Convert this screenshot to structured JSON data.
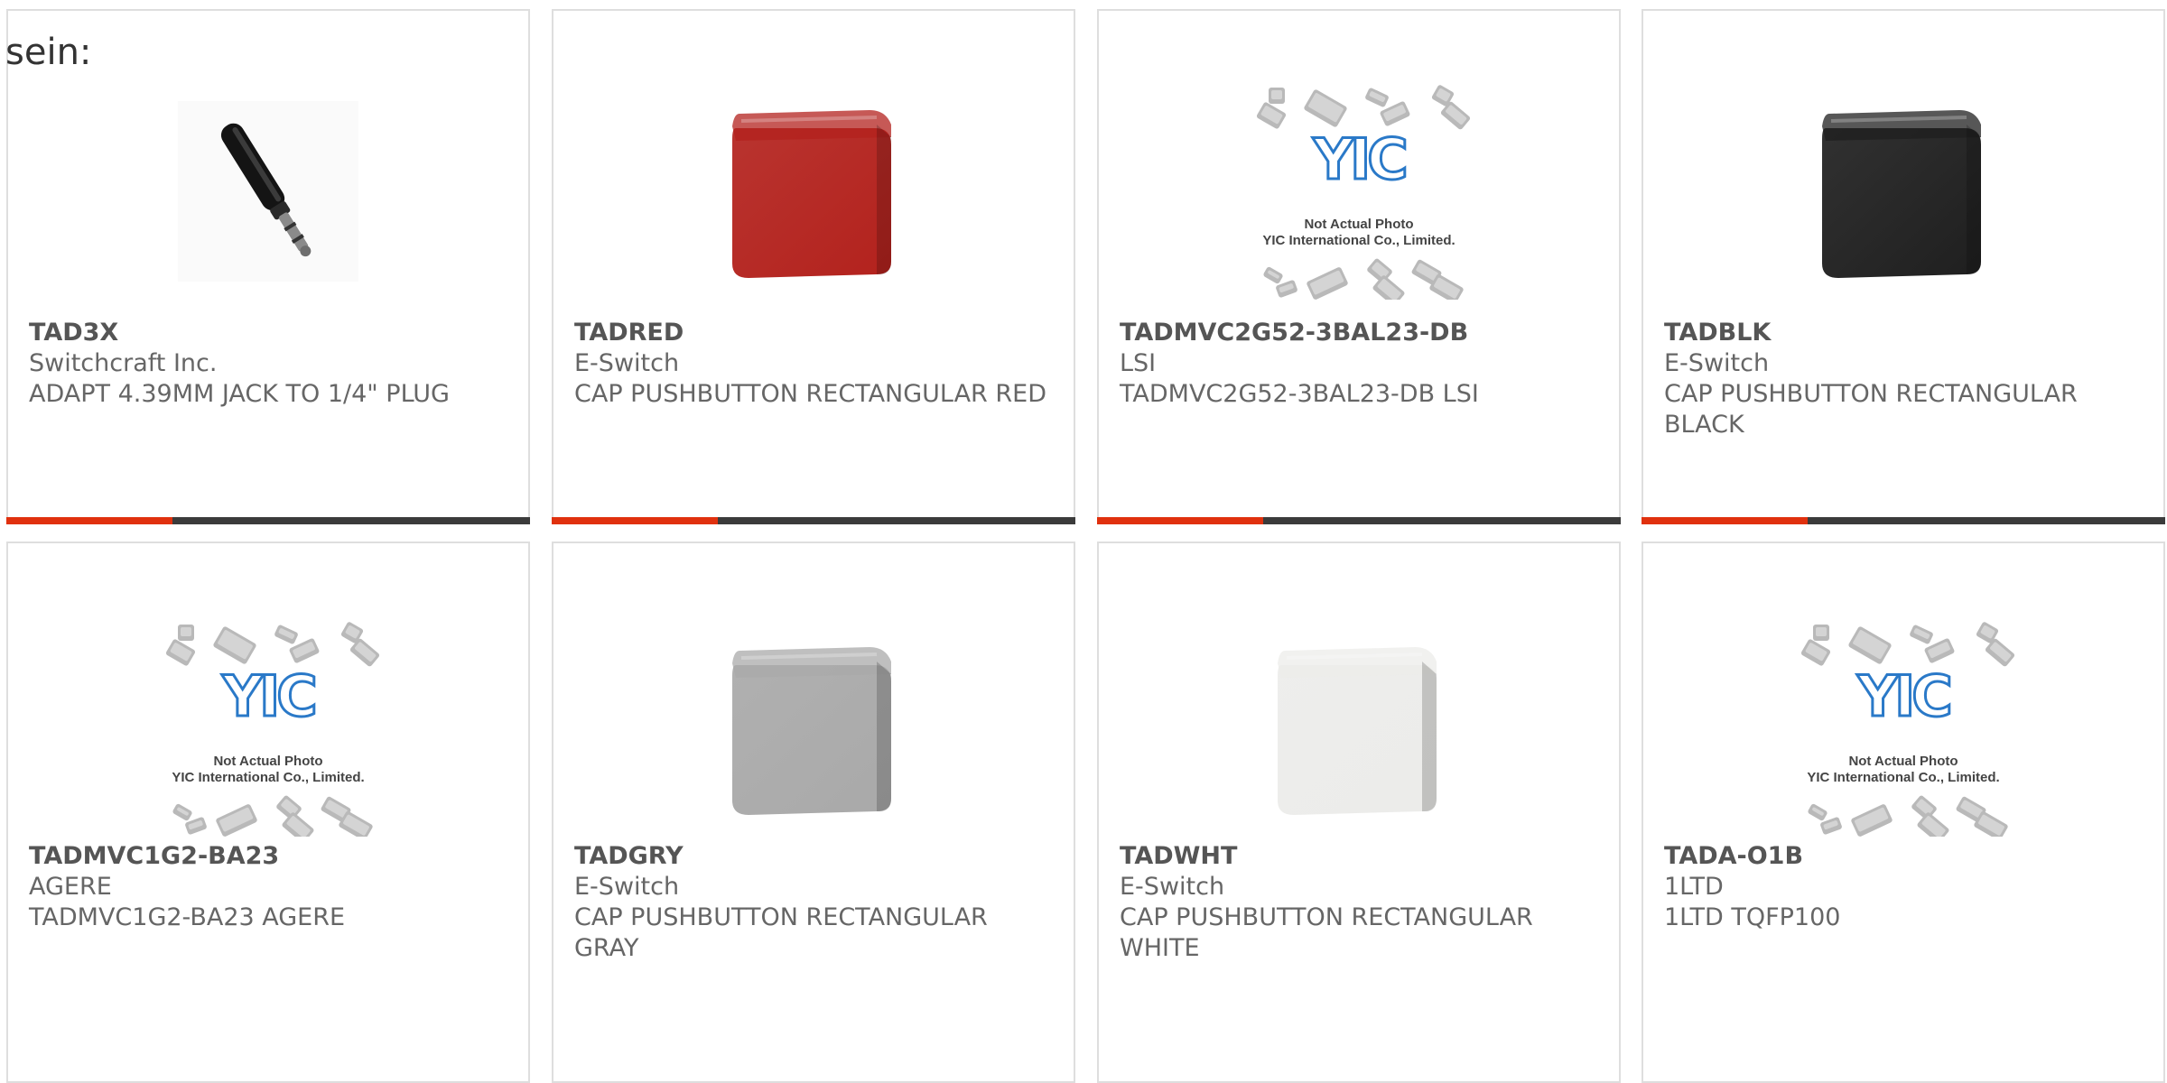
{
  "page": {
    "intro_text": "sein:"
  },
  "theme": {
    "accent": "#e0310e",
    "bar": "#3b3b3b",
    "border": "#dedede"
  },
  "cards": [
    {
      "part_number": "TAD3X",
      "manufacturer": "Switchcraft Inc.",
      "description": "ADAPT 4.39MM JACK TO 1/4\" PLUG",
      "image": "plug-adapter"
    },
    {
      "part_number": "TADRED",
      "manufacturer": "E-Switch",
      "description": "CAP PUSHBUTTON RECTANGULAR RED",
      "image": "cap-red"
    },
    {
      "part_number": "TADMVC2G52-3BAL23-DB",
      "manufacturer": "LSI",
      "description": "TADMVC2G52-3BAL23-DB LSI",
      "image": "placeholder"
    },
    {
      "part_number": "TADBLK",
      "manufacturer": "E-Switch",
      "description": "CAP PUSHBUTTON RECTANGULAR BLACK",
      "image": "cap-black"
    },
    {
      "part_number": "TADMVC1G2-BA23",
      "manufacturer": "AGERE",
      "description": "TADMVC1G2-BA23 AGERE",
      "image": "placeholder"
    },
    {
      "part_number": "TADGRY",
      "manufacturer": "E-Switch",
      "description": "CAP PUSHBUTTON RECTANGULAR GRAY",
      "image": "cap-gray"
    },
    {
      "part_number": "TADWHT",
      "manufacturer": "E-Switch",
      "description": "CAP PUSHBUTTON RECTANGULAR WHITE",
      "image": "cap-white"
    },
    {
      "part_number": "TADA-O1B",
      "manufacturer": "1LTD",
      "description": "1LTD TQFP100",
      "image": "placeholder"
    }
  ],
  "placeholder_image": {
    "logo_text": "YIC",
    "line1": "Not Actual Photo",
    "line2": "YIC International Co., Limited."
  },
  "cap_colors": {
    "cap-red": "#b3221d",
    "cap-black": "#1f1f1f",
    "cap-gray": "#a9a9a9",
    "cap-white": "#ececea"
  }
}
